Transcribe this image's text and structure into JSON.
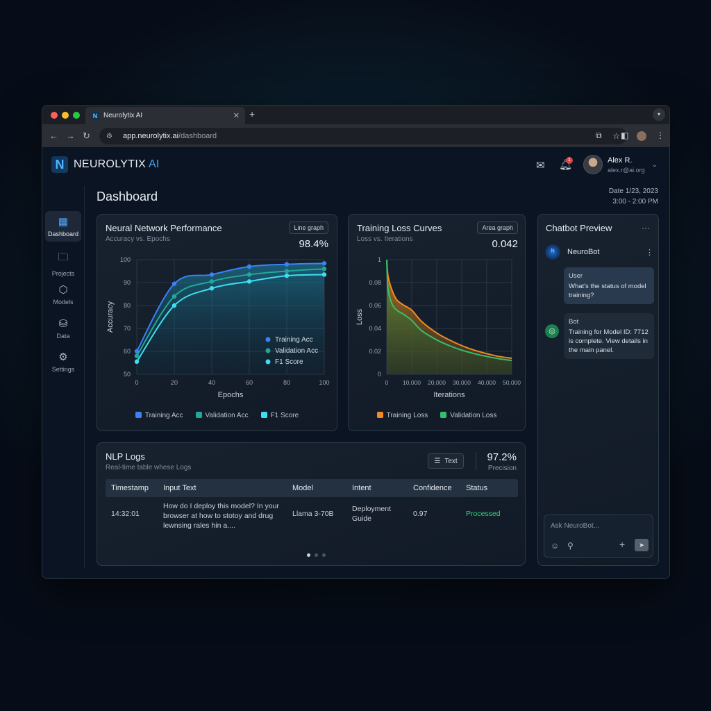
{
  "browser": {
    "tab_title": "Neurolytix AI",
    "tab_favicon": "N",
    "url_host": "app.neurolytix.ai",
    "url_path": "/dashboard"
  },
  "header": {
    "brand_main": "NEUROLYTIX",
    "brand_ai": "AI",
    "notification_count": "1",
    "user_name": "Alex R.",
    "user_email": "alex.r@ai.org"
  },
  "sidebar": {
    "items": [
      {
        "label": "Dashboard",
        "icon": "grid-icon"
      },
      {
        "label": "Projects",
        "icon": "folder-icon"
      },
      {
        "label": "Models",
        "icon": "cube-icon"
      },
      {
        "label": "Data",
        "icon": "database-icon"
      },
      {
        "label": "Settings",
        "icon": "gear-icon"
      }
    ]
  },
  "page": {
    "title": "Dashboard",
    "date_line": "Date 1/23, 2023",
    "time_line": "3:00 - 2:00 PM"
  },
  "perf_card": {
    "title": "Neural Network Performance",
    "subtitle": "Accuracy vs. Epochs",
    "chip": "Line graph",
    "metric": "98.4%"
  },
  "loss_card": {
    "title": "Training Loss Curves",
    "subtitle": "Loss vs. Iterations",
    "chip": "Area graph",
    "metric": "0.042"
  },
  "chart_data": [
    {
      "type": "line",
      "x": [
        0,
        20,
        40,
        60,
        80,
        100
      ],
      "xlabel": "Epochs",
      "ylabel": "Accuracy",
      "xlim": [
        0,
        100
      ],
      "ylim": [
        50,
        100
      ],
      "xticks": [
        "0",
        "20",
        "40",
        "60",
        "80",
        "100"
      ],
      "yticks": [
        "50",
        "60",
        "70",
        "80",
        "90",
        "100"
      ],
      "grid": true,
      "legend_position": "bottom-right",
      "series": [
        {
          "name": "Training Acc",
          "color": "#3b82f6",
          "values": [
            60,
            89.5,
            93.5,
            97,
            98,
            98.4
          ]
        },
        {
          "name": "Validation Acc",
          "color": "#22a89a",
          "values": [
            58,
            84,
            90.5,
            93.5,
            95,
            96
          ]
        },
        {
          "name": "F1 Score",
          "color": "#3de0f0",
          "values": [
            55.5,
            80,
            87.5,
            90.5,
            93,
            93.5
          ]
        }
      ]
    },
    {
      "type": "area",
      "x": [
        0,
        10000,
        20000,
        30000,
        40000,
        50000
      ],
      "xlabel": "Iterations",
      "ylabel": "Loss",
      "xlim": [
        0,
        50000
      ],
      "ylim": [
        0,
        0.1
      ],
      "xticks": [
        "0",
        "10,000",
        "20,000",
        "30,000",
        "40,000",
        "50,000"
      ],
      "yticks": [
        "0",
        "0.02",
        "0.04",
        "0.06",
        "0.08",
        "1"
      ],
      "grid": true,
      "legend_position": "bottom",
      "series": [
        {
          "name": "Training Loss",
          "color": "#f08a24",
          "x": [
            0,
            500,
            2000,
            4000,
            7000,
            10000,
            14000,
            20000,
            25000,
            30000,
            35000,
            40000,
            45000,
            50000
          ],
          "values": [
            0.1,
            0.086,
            0.074,
            0.065,
            0.06,
            0.056,
            0.046,
            0.036,
            0.03,
            0.025,
            0.021,
            0.018,
            0.0155,
            0.014
          ]
        },
        {
          "name": "Validation Loss",
          "color": "#34c06a",
          "x": [
            0,
            500,
            2000,
            4000,
            7000,
            10000,
            14000,
            20000,
            25000,
            30000,
            35000,
            40000,
            45000,
            50000
          ],
          "values": [
            0.1,
            0.075,
            0.062,
            0.056,
            0.052,
            0.047,
            0.038,
            0.03,
            0.025,
            0.021,
            0.018,
            0.0155,
            0.0135,
            0.012
          ]
        }
      ]
    }
  ],
  "chatbot": {
    "title": "Chatbot Preview",
    "bot_name": "NeuroBot",
    "messages": [
      {
        "who": "User",
        "text": "What's the status of model training?"
      },
      {
        "who": "Bot",
        "text": "Training for Model ID: 7712 is complete. View details in the main panel."
      }
    ],
    "input_placeholder": "Ask NeuroBot..."
  },
  "logs": {
    "title": "NLP Logs",
    "subtitle": "Real-time table whese Logs",
    "button": "Text",
    "precision_value": "97.2%",
    "precision_label": "Precision",
    "columns": [
      "Timestamp",
      "Input Text",
      "Model",
      "Intent",
      "Confidence",
      "Status"
    ],
    "rows": [
      {
        "timestamp": "14:32:01",
        "input": "How do I deploy this model? In your browser at how to stotoy and drug lewnsing rales hin a....",
        "model": "Llama 3-70B",
        "intent": "Deployment Guide",
        "confidence": "0.97",
        "status": "Processed"
      }
    ],
    "status_color": "#2fd37a"
  }
}
